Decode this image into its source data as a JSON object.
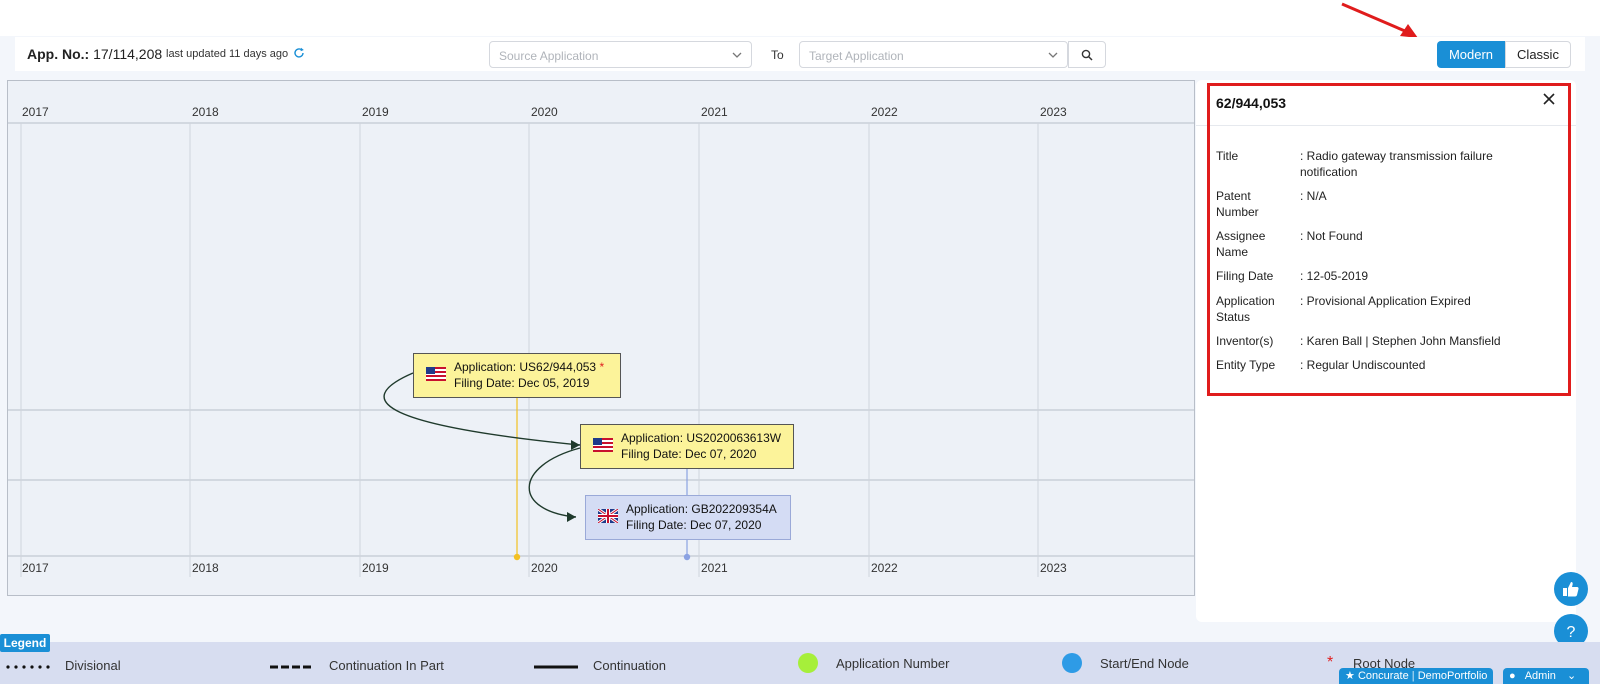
{
  "toolbar": {
    "app_no_label": "App. No.:",
    "app_no_value": "17/114,208",
    "updated_text": "last updated 11 days ago",
    "source_placeholder": "Source Application",
    "to_label": "To",
    "target_placeholder": "Target Application",
    "view_modern": "Modern",
    "view_classic": "Classic"
  },
  "timeline": {
    "years_top": [
      "2017",
      "2018",
      "2019",
      "2020",
      "2021",
      "2022",
      "2023"
    ],
    "years_bottom": [
      "2017",
      "2018",
      "2019",
      "2020",
      "2021",
      "2022",
      "2023"
    ],
    "nodes": [
      {
        "application": "Application: US62/944,053",
        "root_marker": "*",
        "filing": "Filing Date: Dec 05, 2019",
        "country": "US"
      },
      {
        "application": "Application: US2020063613W",
        "filing": "Filing Date: Dec 07, 2020",
        "country": "US"
      },
      {
        "application": "Application: GB202209354A",
        "filing": "Filing Date: Dec 07, 2020",
        "country": "GB"
      }
    ]
  },
  "details": {
    "title": "62/944,053",
    "rows": [
      {
        "key": "Title",
        "value": ": Radio gateway transmission failure notification"
      },
      {
        "key": "Patent Number",
        "value": ": N/A"
      },
      {
        "key": "Assignee Name",
        "value": ": Not Found"
      },
      {
        "key": "Filing Date",
        "value": ": 12-05-2019"
      },
      {
        "key": "Application Status",
        "value": ": Provisional Application Expired"
      },
      {
        "key": "Inventor(s)",
        "value": ": Karen Ball | Stephen John Mansfield"
      },
      {
        "key": "Entity Type",
        "value": ": Regular Undiscounted"
      }
    ]
  },
  "legend": {
    "tag": "Legend",
    "items": {
      "divisional": "Divisional",
      "cip": "Continuation In Part",
      "continuation": "Continuation",
      "app_number": "Application Number",
      "start_end": "Start/End Node",
      "root_marker": "*",
      "root": "Root Node"
    }
  },
  "footer": {
    "brand": "Concurate",
    "portfolio": "DemoPortfolio",
    "user": "Admin"
  },
  "colors": {
    "accent": "#1a8fd6",
    "us_node": "#fcf39a",
    "gb_node": "#d4dcf4",
    "highlight": "#e01c1c",
    "app_number_dot": "#a6ef3a",
    "start_end_dot": "#2e9be6"
  }
}
